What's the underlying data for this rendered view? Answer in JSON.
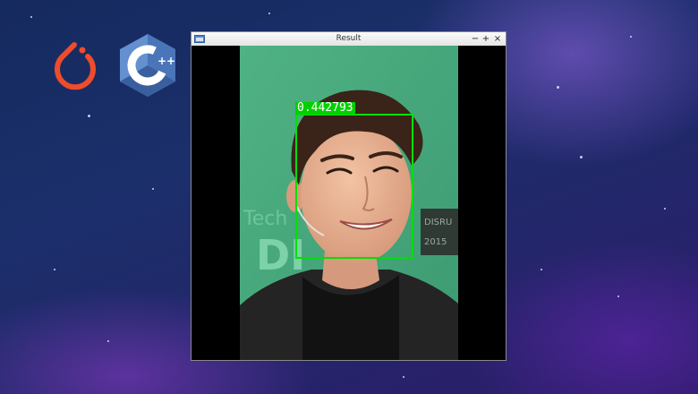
{
  "background": {
    "colors": {
      "deep_blue": "#152a5e",
      "purple_glow": "#8c3cc8"
    }
  },
  "logos": [
    {
      "name": "pytorch-logo",
      "color": "#ee4c2c"
    },
    {
      "name": "cpp-logo",
      "color": "#5b87c8",
      "text": "C",
      "superscript": "++"
    }
  ],
  "window": {
    "title": "Result",
    "icon": "app-window-icon",
    "buttons": {
      "minimize": "−",
      "maximize": "+",
      "close": "×"
    }
  },
  "image": {
    "subject": "portrait photo of a smiling man",
    "detection": {
      "score_label": "0.442793",
      "box_color": "#00e000"
    }
  }
}
